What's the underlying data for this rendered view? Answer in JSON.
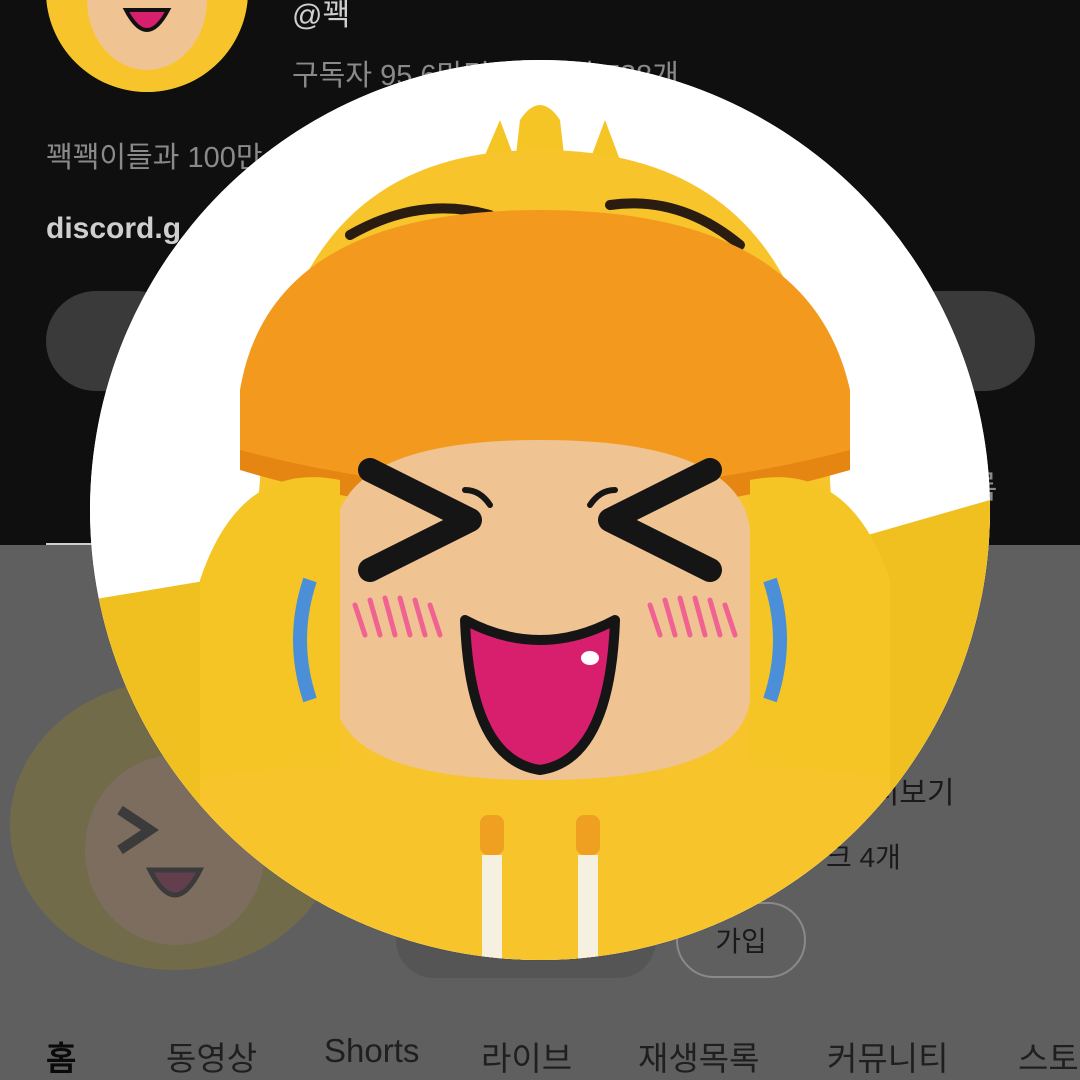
{
  "channel": {
    "handle": "@꽥",
    "stats": "구독자 95.6만명 · 동영상 738개",
    "description": "꽥꽥이들과 100만",
    "link": "discord.g"
  },
  "background_fragments": {
    "right_button_label": "록",
    "more_text": "! ...더보기",
    "links_text": "크 4개"
  },
  "buttons": {
    "join_label": "가입"
  },
  "tabs": [
    {
      "label": "홈",
      "active": true
    },
    {
      "label": "동영상"
    },
    {
      "label": "Shorts"
    },
    {
      "label": "라이브"
    },
    {
      "label": "재생목록"
    },
    {
      "label": "커뮤니티"
    },
    {
      "label": "스토"
    }
  ],
  "colors": {
    "hood_yellow": "#F7C52B",
    "visor_orange": "#F39A1E",
    "skin": "#F0C393",
    "mouth": "#D81F6E",
    "blush": "#F06292",
    "strap_blue": "#4B8FD8"
  },
  "icons": [
    "profile-avatar-icon"
  ]
}
